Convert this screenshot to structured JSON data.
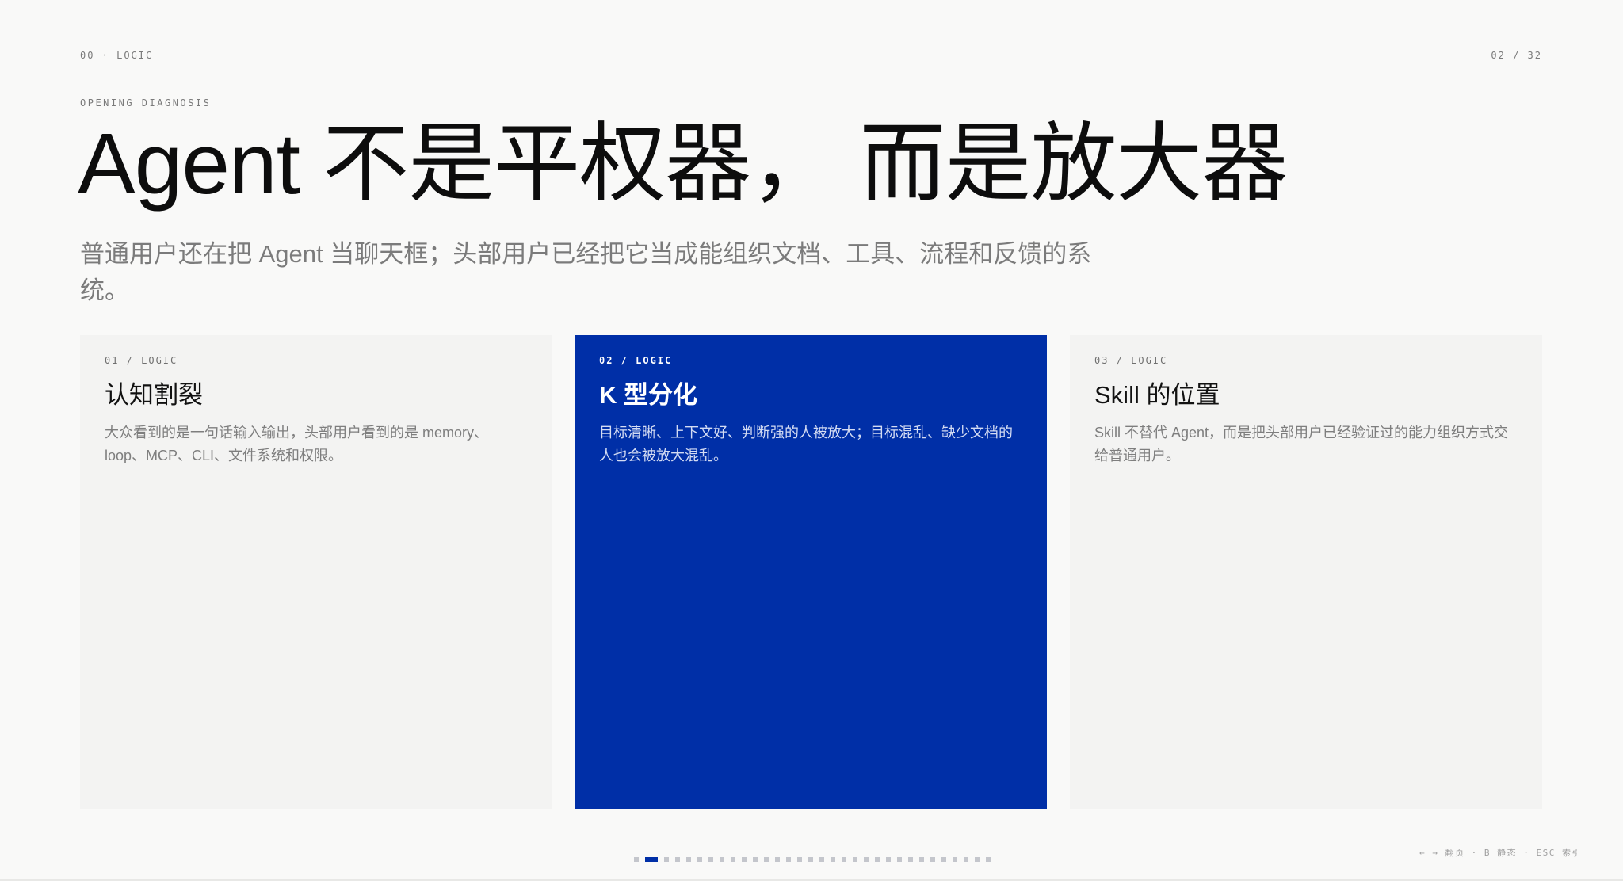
{
  "header": {
    "section_label": "00 · LOGIC",
    "page_counter": "02 / 32"
  },
  "slide": {
    "eyebrow": "OPENING DIAGNOSIS",
    "title": "Agent 不是平权器，  而是放大器",
    "subtitle": "普通用户还在把 Agent 当聊天框；头部用户已经把它当成能组织文档、工具、流程和反馈的系统。"
  },
  "cards": [
    {
      "kicker": "01 / LOGIC",
      "title": "认知割裂",
      "body": "大众看到的是一句话输入输出，头部用户看到的是 memory、loop、MCP、CLI、文件系统和权限。"
    },
    {
      "kicker": "02 / LOGIC",
      "title": "K 型分化",
      "body": "目标清晰、上下文好、判断强的人被放大；目标混乱、缺少文档的人也会被放大混乱。"
    },
    {
      "kicker": "03 / LOGIC",
      "title": "Skill 的位置",
      "body": "Skill 不替代 Agent，而是把头部用户已经验证过的能力组织方式交给普通用户。"
    }
  ],
  "pagination": {
    "total": 32,
    "current": 2
  },
  "footer": {
    "hint": "← → 翻页 · B 静态 · ESC 索引"
  },
  "colors": {
    "accent": "#002fa7",
    "background": "#f9f9f8",
    "card": "#f3f3f2"
  }
}
